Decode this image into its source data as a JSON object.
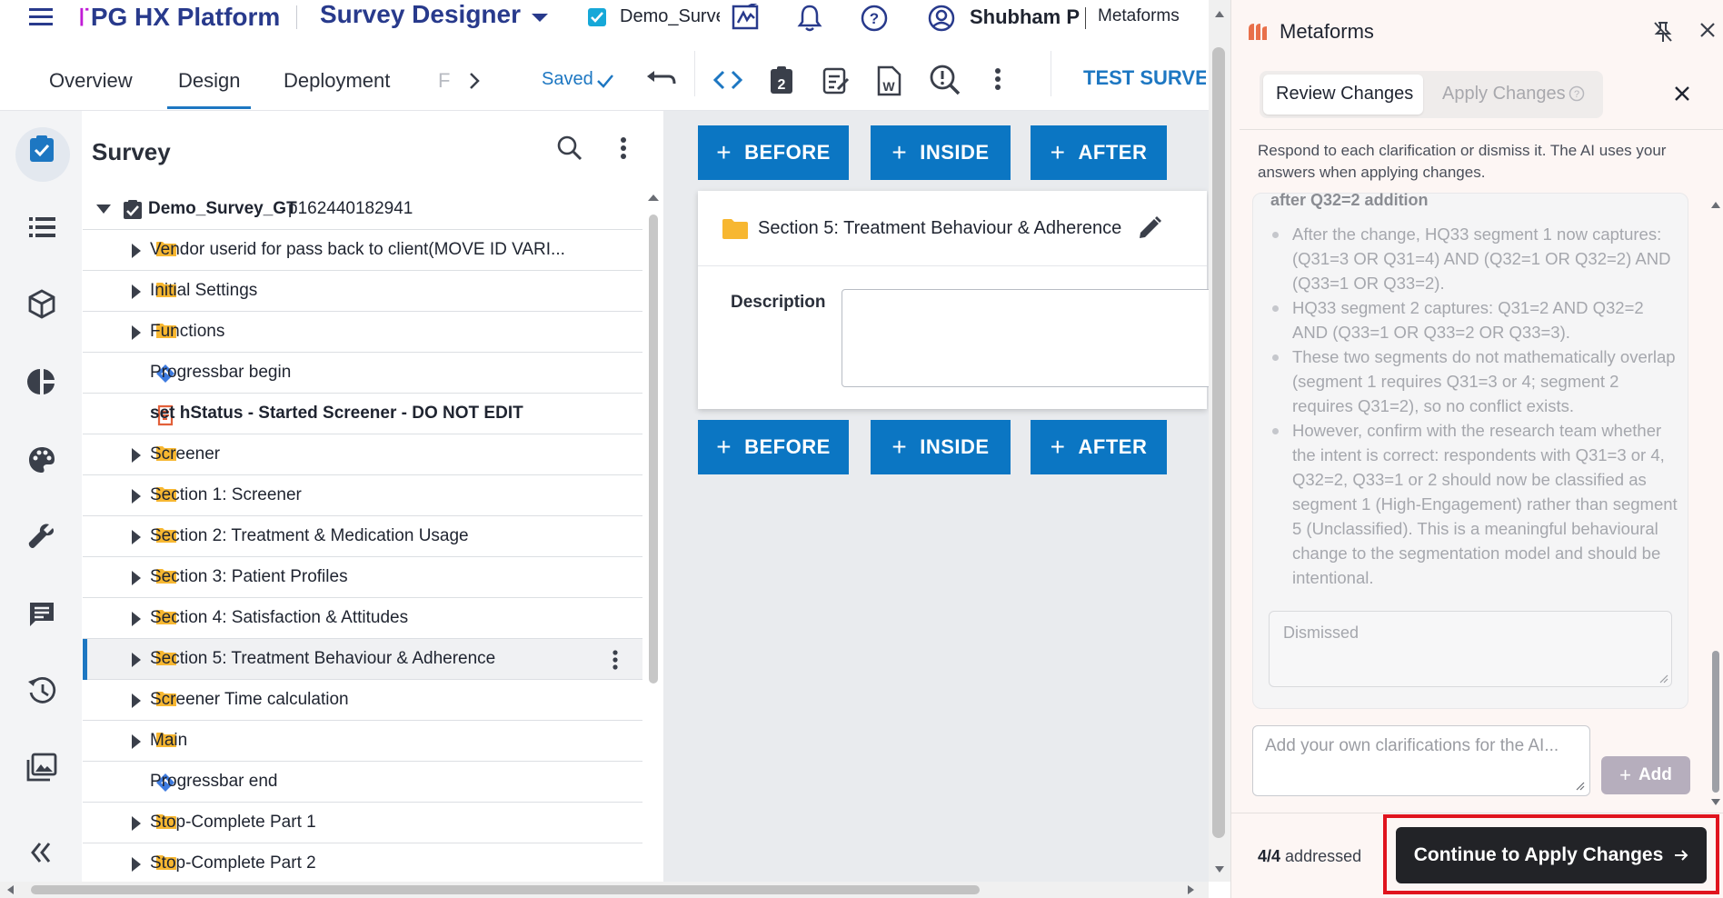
{
  "topbar": {
    "brand_mark": "꜍",
    "brand_name": "PG HX Platform",
    "product": "Survey Designer",
    "survey_name": "Demo_Survey",
    "user_name": "Shubham P",
    "org_name": "Metaforms",
    "icons": [
      "menu-icon",
      "chevron-down-icon",
      "checkbox-icon",
      "signature-icon",
      "bell-icon",
      "help-icon",
      "user-circle-icon"
    ]
  },
  "tabs": {
    "overview": "Overview",
    "design": "Design",
    "deployment": "Deployment",
    "more": "F",
    "saved": "Saved",
    "test_survey": "TEST SURVEY"
  },
  "tree": {
    "title": "Survey",
    "root_name": "Demo_Survey_GT",
    "root_id": "p162440182941",
    "items": [
      {
        "label": "Vendor userid for pass back to client(MOVE ID VARI...",
        "kind": "folder"
      },
      {
        "label": "Initial Settings",
        "kind": "folder"
      },
      {
        "label": "Functions",
        "kind": "folder"
      },
      {
        "label": "Progressbar begin",
        "kind": "progress"
      },
      {
        "label": "set hStatus - Started Screener - DO NOT EDIT",
        "kind": "script"
      },
      {
        "label": "Screener",
        "kind": "folder"
      },
      {
        "label": "Section 1: Screener",
        "kind": "folder"
      },
      {
        "label": "Section 2: Treatment & Medication Usage",
        "kind": "folder"
      },
      {
        "label": "Section 3: Patient Profiles",
        "kind": "folder"
      },
      {
        "label": "Section 4: Satisfaction & Attitudes",
        "kind": "folder"
      },
      {
        "label": "Section 5: Treatment Behaviour & Adherence",
        "kind": "folder",
        "selected": true
      },
      {
        "label": "Screener Time calculation",
        "kind": "folder"
      },
      {
        "label": "Main",
        "kind": "folder"
      },
      {
        "label": "Progressbar end",
        "kind": "progress"
      },
      {
        "label": "Stop-Complete Part 1",
        "kind": "folder"
      },
      {
        "label": "Stop-Complete Part 2",
        "kind": "folder"
      }
    ]
  },
  "canvas": {
    "before": "BEFORE",
    "inside": "INSIDE",
    "after": "AFTER",
    "section_title": "Section 5: Treatment Behaviour & Adherence",
    "description_label": "Description",
    "description_value": ""
  },
  "panel": {
    "title": "Metaforms",
    "tab_review": "Review Changes",
    "tab_apply": "Apply Changes",
    "intro": "Respond to each clarification or dismiss it. The AI uses your answers when applying changes.",
    "card_heading": "after Q32=2 addition",
    "bullets": [
      "After the change, HQ33 segment 1 now captures: (Q31=3 OR Q31=4) AND (Q32=1 OR Q32=2) AND (Q33=1 OR Q33=2).",
      "HQ33 segment 2 captures: Q31=2 AND Q32=2 AND (Q33=1 OR Q33=2 OR Q33=3).",
      "These two segments do not mathematically overlap (segment 1 requires Q31=3 or 4; segment 2 requires Q31=2), so no conflict exists.",
      "However, confirm with the research team whether the intent is correct: respondents with Q31=3 or 4, Q32=2, Q33=1 or 2 should now be classified as segment 1 (High-Engagement) rather than segment 5 (Unclassified). This is a meaningful behavioural change to the segmentation model and should be intentional."
    ],
    "dismissed_placeholder": "Dismissed",
    "clarification_placeholder": "Add your own clarifications for the AI...",
    "add_label": "Add",
    "addressed_count": "4/4",
    "addressed_label": "addressed",
    "continue_label": "Continue to Apply Changes",
    "accent_color": "#e0141e"
  }
}
